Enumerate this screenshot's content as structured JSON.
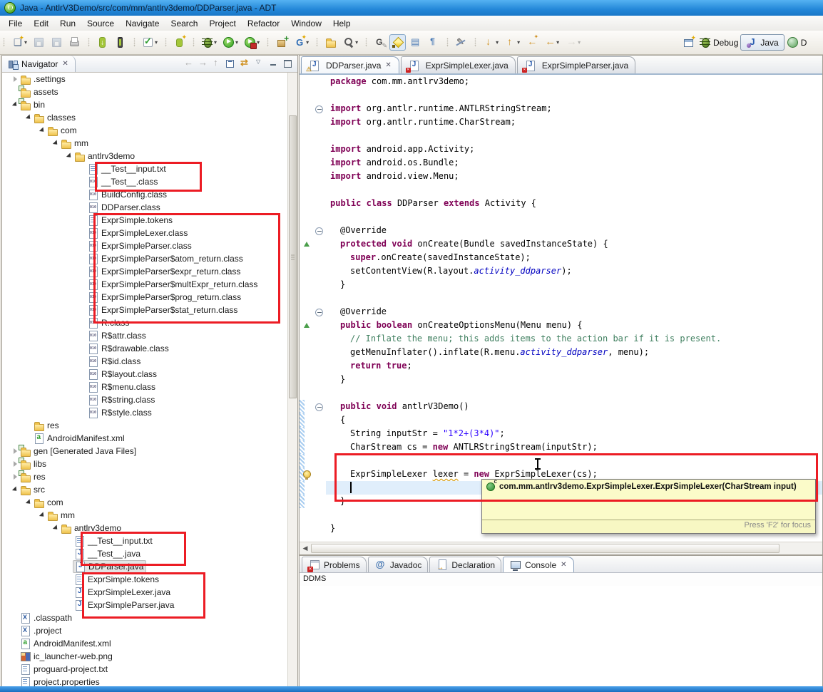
{
  "colors": {
    "annotation_red": "#ec1c24",
    "keyword": "#7f0055",
    "string": "#2a00ff",
    "comment": "#3f7f5f",
    "static_ref": "#0000c0",
    "current_line": "#e0eefb",
    "tooltip_bg": "#fbfbc9",
    "titlebar_blue": "#2387d8"
  },
  "window": {
    "title": "Java - AntlrV3Demo/src/com/mm/antlrv3demo/DDParser.java - ADT"
  },
  "menu": {
    "items": [
      "File",
      "Edit",
      "Run",
      "Source",
      "Navigate",
      "Search",
      "Project",
      "Refactor",
      "Window",
      "Help"
    ]
  },
  "toolbar": {
    "groups": [
      {
        "items": [
          {
            "name": "new-wizard-button",
            "icon": "new-icon",
            "dd": true
          },
          {
            "name": "save-button",
            "icon": "save-icon",
            "disabled": true
          },
          {
            "name": "save-all-button",
            "icon": "save-all-icon",
            "disabled": true
          },
          {
            "name": "print-button",
            "icon": "print-icon"
          }
        ]
      },
      {
        "items": [
          {
            "name": "android-sdk-manager-button",
            "icon": "android-sdk-icon"
          },
          {
            "name": "avd-manager-button",
            "icon": "avd-icon"
          }
        ]
      },
      {
        "items": [
          {
            "name": "lint-button",
            "icon": "lint-check-icon",
            "dd": true
          }
        ]
      },
      {
        "items": [
          {
            "name": "new-android-project-button",
            "icon": "new-android-project-icon"
          }
        ]
      },
      {
        "items": [
          {
            "name": "debug-button",
            "icon": "debug-icon",
            "dd": true
          },
          {
            "name": "run-button",
            "icon": "run-icon",
            "dd": true
          },
          {
            "name": "external-tools-button",
            "icon": "external-tools-icon",
            "dd": true,
            "sub": true
          }
        ]
      },
      {
        "items": [
          {
            "name": "new-package-button",
            "icon": "package-icon"
          },
          {
            "name": "trace-button",
            "icon": "opengl-trace-icon",
            "dd": true
          }
        ]
      },
      {
        "items": [
          {
            "name": "open-resource-button",
            "icon": "open-folder-icon"
          },
          {
            "name": "search-button",
            "icon": "search-icon",
            "dd": true
          }
        ]
      },
      {
        "items": [
          {
            "name": "javadoc-button",
            "icon": "javadoc-g-icon"
          },
          {
            "name": "mark-occurrences-button",
            "icon": "highlighter-icon",
            "pressed": true
          },
          {
            "name": "block-selection-button",
            "icon": "block-selection-icon"
          },
          {
            "name": "show-whitespace-button",
            "icon": "pilcrow-icon"
          }
        ]
      },
      {
        "items": [
          {
            "name": "show-source-button",
            "icon": "pen-slash-icon"
          }
        ]
      },
      {
        "items": [
          {
            "name": "next-annotation-button",
            "icon": "arrow-down-icon",
            "dd": true
          },
          {
            "name": "previous-annotation-button",
            "icon": "arrow-up-icon",
            "dd": true
          },
          {
            "name": "last-edit-location-button",
            "icon": "arrow-back-star-icon"
          },
          {
            "name": "back-button",
            "icon": "arrow-left-icon",
            "dd": true
          },
          {
            "name": "forward-button",
            "icon": "arrow-right-icon",
            "dd": true,
            "disabled": true
          }
        ]
      }
    ],
    "perspectives": [
      {
        "label": "",
        "icon": "open-perspective-icon",
        "name": "open-perspective-button"
      },
      {
        "label": "Debug",
        "icon": "debug-icon",
        "name": "perspective-debug"
      },
      {
        "label": "Java",
        "icon": "java-perspective-icon",
        "name": "perspective-java",
        "active": true
      },
      {
        "label": "D",
        "icon": "ddms-perspective-icon",
        "name": "perspective-ddms"
      }
    ]
  },
  "navigator": {
    "title": "Navigator",
    "tree": [
      {
        "label": ".settings",
        "level": 1,
        "arrow": "closed",
        "icon": "folder"
      },
      {
        "label": "assets",
        "level": 1,
        "arrow": "none",
        "icon": "folder-src"
      },
      {
        "label": "bin",
        "level": 1,
        "arrow": "open",
        "icon": "folder-src"
      },
      {
        "label": "classes",
        "level": 2,
        "arrow": "open",
        "icon": "folder"
      },
      {
        "label": "com",
        "level": 3,
        "arrow": "open",
        "icon": "folder"
      },
      {
        "label": "mm",
        "level": 4,
        "arrow": "open",
        "icon": "folder"
      },
      {
        "label": "antlrv3demo",
        "level": 5,
        "arrow": "open",
        "icon": "folder"
      },
      {
        "label": "__Test__input.txt",
        "level": 6,
        "icon": "txt"
      },
      {
        "label": "__Test__.class",
        "level": 6,
        "icon": "class"
      },
      {
        "label": "BuildConfig.class",
        "level": 6,
        "icon": "class"
      },
      {
        "label": "DDParser.class",
        "level": 6,
        "icon": "class"
      },
      {
        "label": "ExprSimple.tokens",
        "level": 6,
        "icon": "txt"
      },
      {
        "label": "ExprSimpleLexer.class",
        "level": 6,
        "icon": "class"
      },
      {
        "label": "ExprSimpleParser.class",
        "level": 6,
        "icon": "class"
      },
      {
        "label": "ExprSimpleParser$atom_return.class",
        "level": 6,
        "icon": "class"
      },
      {
        "label": "ExprSimpleParser$expr_return.class",
        "level": 6,
        "icon": "class"
      },
      {
        "label": "ExprSimpleParser$multExpr_return.class",
        "level": 6,
        "icon": "class"
      },
      {
        "label": "ExprSimpleParser$prog_return.class",
        "level": 6,
        "icon": "class"
      },
      {
        "label": "ExprSimpleParser$stat_return.class",
        "level": 6,
        "icon": "class"
      },
      {
        "label": "R.class",
        "level": 6,
        "icon": "class"
      },
      {
        "label": "R$attr.class",
        "level": 6,
        "icon": "class"
      },
      {
        "label": "R$drawable.class",
        "level": 6,
        "icon": "class"
      },
      {
        "label": "R$id.class",
        "level": 6,
        "icon": "class"
      },
      {
        "label": "R$layout.class",
        "level": 6,
        "icon": "class"
      },
      {
        "label": "R$menu.class",
        "level": 6,
        "icon": "class"
      },
      {
        "label": "R$string.class",
        "level": 6,
        "icon": "class"
      },
      {
        "label": "R$style.class",
        "level": 6,
        "icon": "class"
      },
      {
        "label": "res",
        "level": 2,
        "icon": "folder"
      },
      {
        "label": "AndroidManifest.xml",
        "level": 2,
        "icon": "manifest"
      },
      {
        "label": "gen [Generated Java Files]",
        "level": 1,
        "arrow": "closed",
        "icon": "folder-src"
      },
      {
        "label": "libs",
        "level": 1,
        "arrow": "closed",
        "icon": "folder-src"
      },
      {
        "label": "res",
        "level": 1,
        "arrow": "closed",
        "icon": "folder-src"
      },
      {
        "label": "src",
        "level": 1,
        "arrow": "open",
        "icon": "folder"
      },
      {
        "label": "com",
        "level": 2,
        "arrow": "open",
        "icon": "folder"
      },
      {
        "label": "mm",
        "level": 3,
        "arrow": "open",
        "icon": "folder"
      },
      {
        "label": "antlrv3demo",
        "level": 4,
        "arrow": "open",
        "icon": "folder"
      },
      {
        "label": "__Test__input.txt",
        "level": 5,
        "icon": "txt"
      },
      {
        "label": "__Test__.java",
        "level": 5,
        "icon": "java"
      },
      {
        "label": "DDParser.java",
        "level": 5,
        "icon": "java",
        "selected": true
      },
      {
        "label": "ExprSimple.tokens",
        "level": 5,
        "icon": "txt"
      },
      {
        "label": "ExprSimpleLexer.java",
        "level": 5,
        "icon": "java"
      },
      {
        "label": "ExprSimpleParser.java",
        "level": 5,
        "icon": "java"
      },
      {
        "label": ".classpath",
        "level": 1,
        "icon": "xml"
      },
      {
        "label": ".project",
        "level": 1,
        "icon": "xml"
      },
      {
        "label": "AndroidManifest.xml",
        "level": 1,
        "icon": "manifest"
      },
      {
        "label": "ic_launcher-web.png",
        "level": 1,
        "icon": "img"
      },
      {
        "label": "proguard-project.txt",
        "level": 1,
        "icon": "txt"
      },
      {
        "label": "project.properties",
        "level": 1,
        "icon": "txt"
      }
    ]
  },
  "editor": {
    "tabs": [
      {
        "label": "DDParser.java",
        "active": true,
        "decor": "warn",
        "closable": true
      },
      {
        "label": "ExprSimpleLexer.java",
        "decor": "err"
      },
      {
        "label": "ExprSimpleParser.java",
        "decor": "err"
      }
    ],
    "code": {
      "lines": [
        {
          "seg": [
            [
              "package",
              "k"
            ],
            [
              " com.mm.antlrv3demo;",
              "p"
            ]
          ]
        },
        {
          "seg": []
        },
        {
          "fold": 1,
          "seg": [
            [
              "import",
              "k"
            ],
            [
              " org.antlr.runtime.ANTLRStringStream;",
              "p"
            ]
          ]
        },
        {
          "seg": [
            [
              "import",
              "k"
            ],
            [
              " org.antlr.runtime.CharStream;",
              "p"
            ]
          ]
        },
        {
          "seg": []
        },
        {
          "seg": [
            [
              "import",
              "k"
            ],
            [
              " android.app.Activity;",
              "p"
            ]
          ]
        },
        {
          "seg": [
            [
              "import",
              "k"
            ],
            [
              " android.os.Bundle;",
              "p"
            ]
          ]
        },
        {
          "seg": [
            [
              "import",
              "k"
            ],
            [
              " android.view.Menu;",
              "p"
            ]
          ]
        },
        {
          "seg": []
        },
        {
          "seg": [
            [
              "public",
              "k"
            ],
            [
              " ",
              "p"
            ],
            [
              "class",
              "k"
            ],
            [
              " DDParser ",
              "p"
            ],
            [
              "extends",
              "k"
            ],
            [
              " Activity {",
              "p"
            ]
          ]
        },
        {
          "seg": []
        },
        {
          "ind": 1,
          "fold": 1,
          "seg": [
            [
              "@Override",
              "p"
            ]
          ]
        },
        {
          "ind": 1,
          "ovr": 1,
          "seg": [
            [
              "protected",
              "k"
            ],
            [
              " ",
              "p"
            ],
            [
              "void",
              "k"
            ],
            [
              " onCreate(Bundle savedInstanceState) {",
              "p"
            ]
          ]
        },
        {
          "ind": 2,
          "seg": [
            [
              "super",
              "k"
            ],
            [
              ".onCreate(savedInstanceState);",
              "p"
            ]
          ]
        },
        {
          "ind": 2,
          "seg": [
            [
              "setContentView(R.layout.",
              "p"
            ],
            [
              "activity_ddparser",
              "r"
            ],
            [
              ");",
              "p"
            ]
          ]
        },
        {
          "ind": 1,
          "seg": [
            [
              "}",
              "p"
            ]
          ]
        },
        {
          "seg": []
        },
        {
          "ind": 1,
          "fold": 1,
          "seg": [
            [
              "@Override",
              "p"
            ]
          ]
        },
        {
          "ind": 1,
          "ovr": 1,
          "seg": [
            [
              "public",
              "k"
            ],
            [
              " ",
              "p"
            ],
            [
              "boolean",
              "k"
            ],
            [
              " onCreateOptionsMenu(Menu menu) {",
              "p"
            ]
          ]
        },
        {
          "ind": 2,
          "seg": [
            [
              "// Inflate the menu; this adds items to the action bar if it is present.",
              "c"
            ]
          ]
        },
        {
          "ind": 2,
          "seg": [
            [
              "getMenuInflater().inflate(R.menu.",
              "p"
            ],
            [
              "activity_ddparser",
              "r"
            ],
            [
              ", menu);",
              "p"
            ]
          ]
        },
        {
          "ind": 2,
          "seg": [
            [
              "return",
              "k"
            ],
            [
              " ",
              "p"
            ],
            [
              "true",
              "k"
            ],
            [
              ";",
              "p"
            ]
          ]
        },
        {
          "ind": 1,
          "seg": [
            [
              "}",
              "p"
            ]
          ]
        },
        {
          "seg": []
        },
        {
          "ind": 1,
          "fold": 1,
          "diff": 1,
          "seg": [
            [
              "public",
              "k"
            ],
            [
              " ",
              "p"
            ],
            [
              "void",
              "k"
            ],
            [
              " antlrV3Demo()",
              "p"
            ]
          ]
        },
        {
          "ind": 1,
          "diff": 1,
          "seg": [
            [
              "{",
              "p"
            ]
          ]
        },
        {
          "ind": 2,
          "diff": 1,
          "seg": [
            [
              "String inputStr = ",
              "p"
            ],
            [
              "\"1*2+(3*4)\"",
              "s"
            ],
            [
              ";",
              "p"
            ]
          ]
        },
        {
          "ind": 2,
          "diff": 1,
          "seg": [
            [
              "CharStream cs = ",
              "p"
            ],
            [
              "new",
              "k"
            ],
            [
              " ANTLRStringStream(inputStr);",
              "p"
            ]
          ]
        },
        {
          "diff": 1,
          "seg": []
        },
        {
          "ind": 2,
          "diff": 1,
          "bulb": 1,
          "seg": [
            [
              "ExprSimpleLexer ",
              "p"
            ],
            [
              "lexer",
              "w"
            ],
            [
              " = ",
              "p"
            ],
            [
              "new",
              "k"
            ],
            [
              " ExprSimpleLexer(cs);",
              "p"
            ]
          ]
        },
        {
          "ind": 2,
          "diff": 1,
          "cur": 1,
          "caret": 1,
          "seg": []
        },
        {
          "ind": 1,
          "diff": 1,
          "seg": [
            [
              "}",
              "p"
            ]
          ]
        },
        {
          "seg": []
        },
        {
          "seg": [
            [
              "}",
              "p"
            ]
          ]
        }
      ]
    },
    "tooltip": {
      "signature": "com.mm.antlrv3demo.ExprSimpleLexer.ExprSimpleLexer(CharStream input)",
      "hint": "Press 'F2' for focus"
    }
  },
  "bottom": {
    "tabs": [
      {
        "label": "Problems",
        "icon": "problems-icon"
      },
      {
        "label": "Javadoc",
        "icon": "javadoc-at-icon"
      },
      {
        "label": "Declaration",
        "icon": "declaration-icon"
      },
      {
        "label": "Console",
        "icon": "console-icon",
        "active": true,
        "closable": true
      }
    ],
    "console_label": "DDMS"
  }
}
